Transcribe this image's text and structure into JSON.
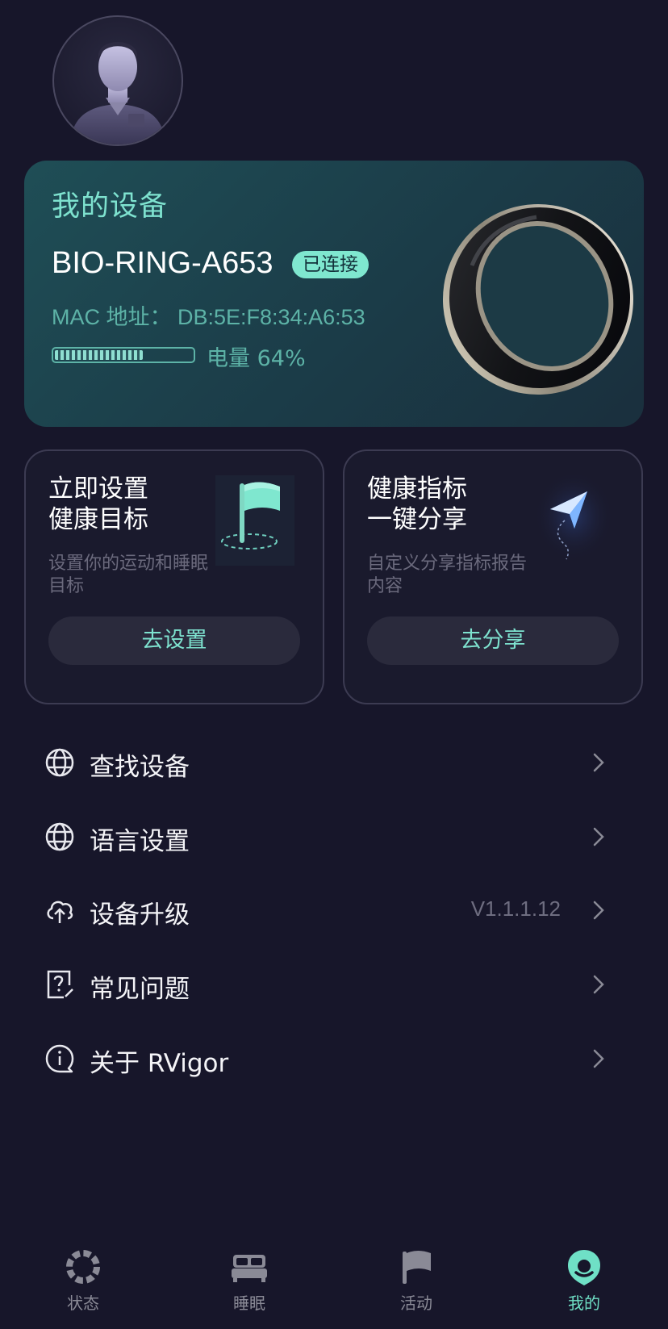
{
  "profile": {
    "avatar_icon": "user-avatar"
  },
  "device": {
    "title": "我的设备",
    "name": "BIO-RING-A653",
    "status": "已连接",
    "mac": "MAC 地址： DB:5E:F8:34:A6:53",
    "battery_percent": 64,
    "battery_label": "电量 64%"
  },
  "cards": {
    "goal": {
      "title_line1": "立即设置",
      "title_line2": "健康目标",
      "subtitle_line1": "设置你的运动和睡眠",
      "subtitle_line2": "目标",
      "button": "去设置"
    },
    "share": {
      "title_line1": "健康指标",
      "title_line2": "一键分享",
      "subtitle_line1": "自定义分享指标报告",
      "subtitle_line2": "内容",
      "button": "去分享"
    }
  },
  "menu": {
    "find_device": "查找设备",
    "language": "语言设置",
    "upgrade": "设备升级",
    "upgrade_version": "V1.1.1.12",
    "faq": "常见问题",
    "about": "关于 RVigor"
  },
  "nav": {
    "status": "状态",
    "sleep": "睡眠",
    "activity": "活动",
    "mine": "我的"
  },
  "colors": {
    "accent": "#7ee2cf",
    "background": "#17162a",
    "card": "#1f4e56"
  }
}
